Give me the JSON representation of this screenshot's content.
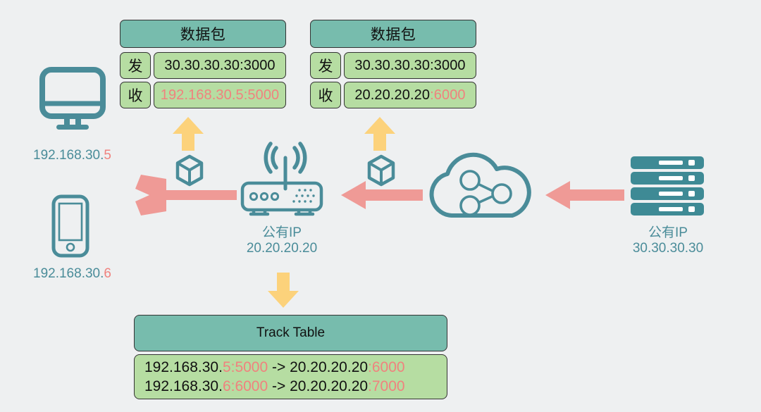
{
  "diagram": {
    "title": "NAT port mapping diagram",
    "colors": {
      "background": "#eef0f1",
      "teal": "#4a8c99",
      "header_green": "#77bcad",
      "cell_green": "#b6dda2",
      "salmon": "#ef9a96",
      "amber": "#fcd27b",
      "red_text": "#f0827e"
    }
  },
  "packet_left": {
    "title": "数据包",
    "rows": [
      {
        "label": "发",
        "value_black": "30.30.30.30:3000",
        "value_red": ""
      },
      {
        "label": "收",
        "value_black": "",
        "value_red": "192.168.30.5:5000"
      }
    ]
  },
  "packet_right": {
    "title": "数据包",
    "rows": [
      {
        "label": "发",
        "value_black": "30.30.30.30:3000",
        "value_red": ""
      },
      {
        "label": "收",
        "value_black": "20.20.20.20",
        "value_red": ":6000"
      }
    ]
  },
  "track_table": {
    "title": "Track Table",
    "rows": [
      {
        "src_prefix": "192.168.30.",
        "src_suffix": "5:5000",
        "arrow": " -> ",
        "dst_prefix": "20.20.20.20",
        "dst_suffix": ":6000"
      },
      {
        "src_prefix": "192.168.30.",
        "src_suffix": "6:6000",
        "arrow": " -> ",
        "dst_prefix": "20.20.20.20",
        "dst_suffix": ":7000"
      }
    ]
  },
  "devices": {
    "desktop": {
      "icon": "desktop-monitor-icon",
      "ip_prefix": "192.168.30.",
      "ip_suffix": "5"
    },
    "phone": {
      "icon": "mobile-phone-icon",
      "ip_prefix": "192.168.30.",
      "ip_suffix": "6"
    },
    "router": {
      "icon": "wifi-router-icon",
      "line1": "公有IP",
      "line2": "20.20.20.20"
    },
    "cloud": {
      "icon": "cloud-network-icon"
    },
    "server": {
      "icon": "server-stack-icon",
      "line1": "公有IP",
      "line2": "30.30.30.30"
    }
  },
  "icons": {
    "packet_cube_left": "package-cube-icon",
    "packet_cube_right": "package-cube-icon",
    "arrow_up_left": "arrow-up-icon",
    "arrow_up_right": "arrow-up-icon",
    "arrow_down_table": "arrow-down-icon",
    "arrow_fork_lan": "forked-arrow-left-icon",
    "arrow_cloud_to_router": "arrow-left-icon",
    "arrow_server_to_cloud": "arrow-left-icon"
  }
}
